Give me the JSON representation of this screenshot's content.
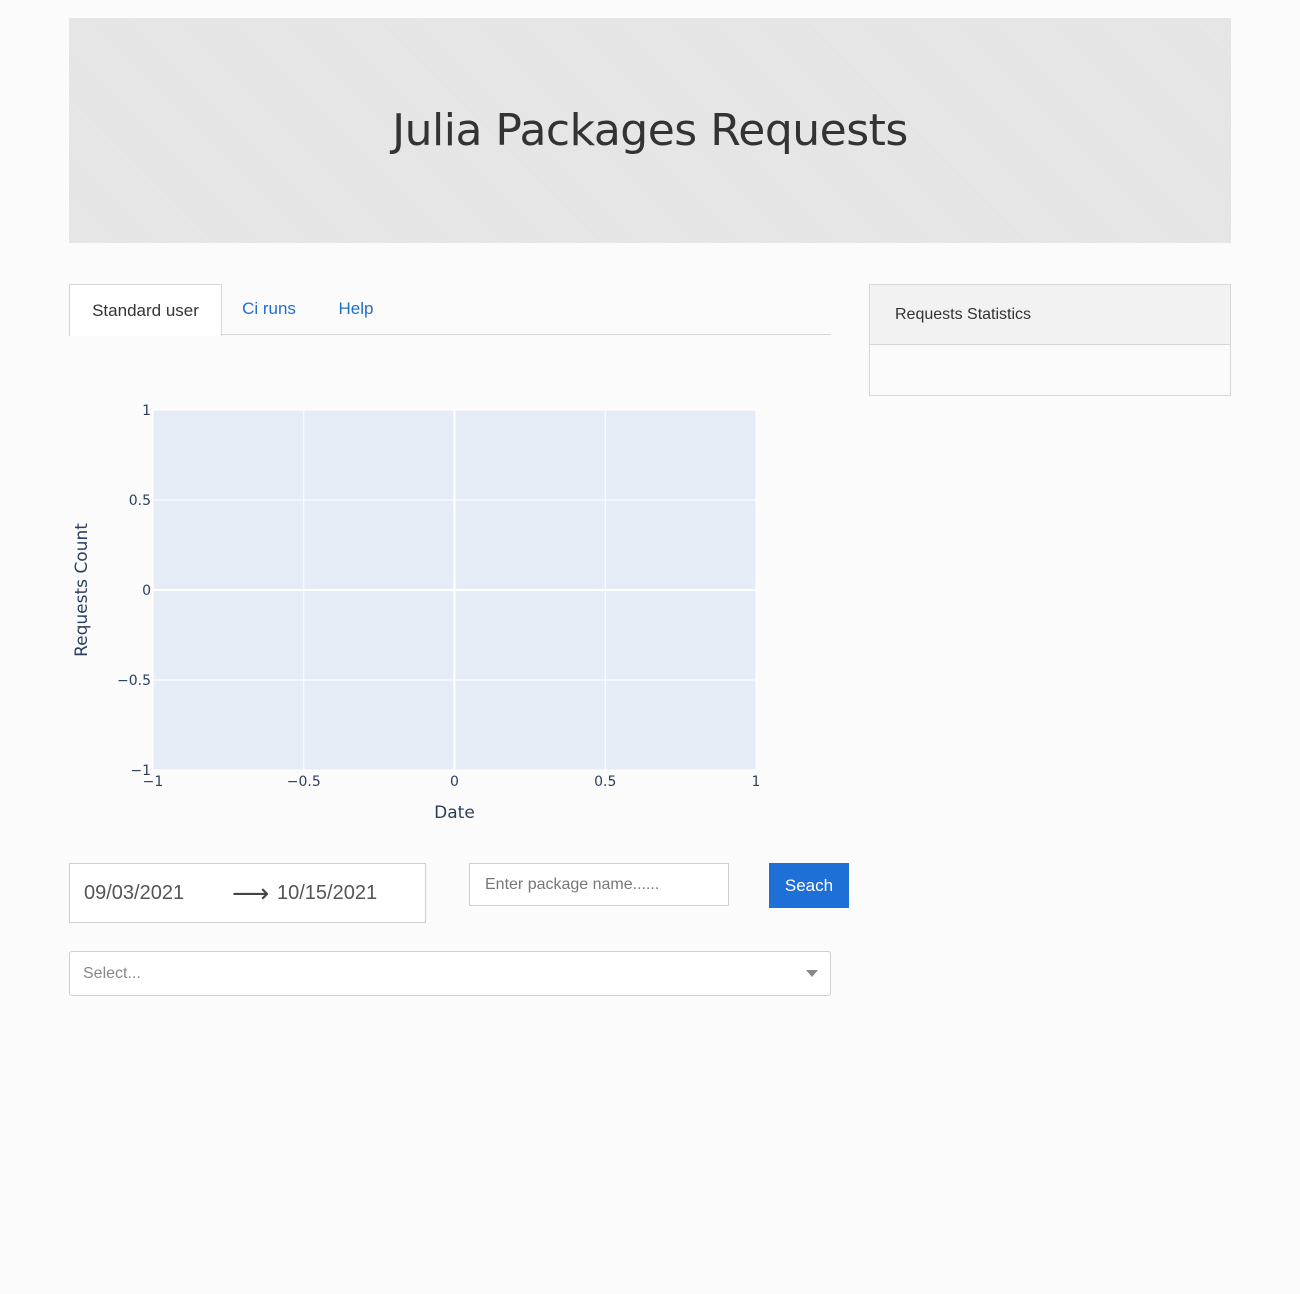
{
  "header": {
    "title": "Julia Packages Requests"
  },
  "tabs": [
    {
      "label": "Standard user",
      "active": true
    },
    {
      "label": "Ci runs",
      "active": false
    },
    {
      "label": "Help",
      "active": false
    }
  ],
  "stats_panel": {
    "title": "Requests Statistics"
  },
  "chart_data": {
    "type": "line",
    "series": [],
    "xlabel": "Date",
    "ylabel": "Requests Count",
    "xlim": [
      -1,
      1
    ],
    "ylim": [
      -1,
      1
    ],
    "x_ticks": [
      "−1",
      "−0.5",
      "0",
      "0.5",
      "1"
    ],
    "y_ticks": [
      "1",
      "0.5",
      "0",
      "−0.5",
      "−1"
    ],
    "grid": true,
    "plot_bg": "#e5ecf6"
  },
  "date_range": {
    "start": "09/03/2021",
    "arrow": "⟶",
    "end": "10/15/2021"
  },
  "package_input": {
    "placeholder": "Enter package name......",
    "value": ""
  },
  "search_button": {
    "label": "Seach"
  },
  "select": {
    "placeholder": "Select..."
  },
  "colors": {
    "accent": "#1e6fd6",
    "link": "#1f6fc9"
  }
}
